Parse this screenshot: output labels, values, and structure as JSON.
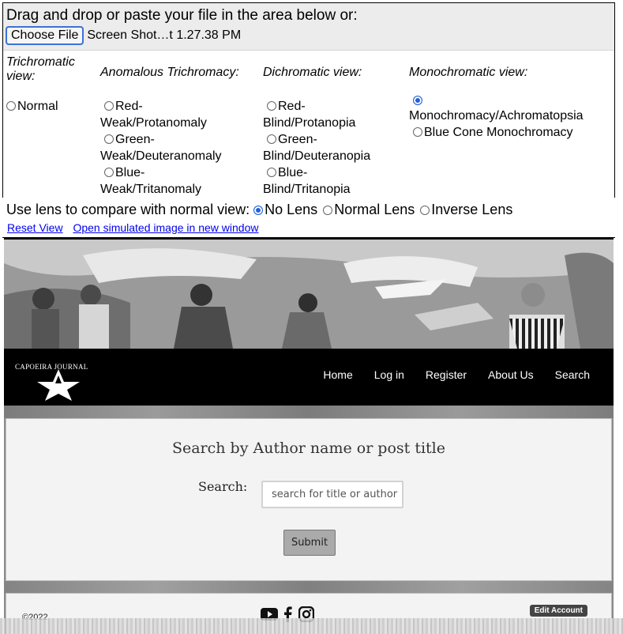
{
  "tool": {
    "drop_label": "Drag and drop or paste your file in the area below or:",
    "choose_file": "Choose File",
    "file_name": "Screen Shot…t 1.27.38 PM",
    "columns": [
      {
        "heading": "Trichromatic view:",
        "options": [
          "Normal"
        ]
      },
      {
        "heading": "Anomalous Trichromacy:",
        "options": [
          "Red-Weak/Protanomaly",
          "Green-Weak/Deuteranomaly",
          "Blue-Weak/Tritanomaly"
        ]
      },
      {
        "heading": "Dichromatic view:",
        "options": [
          "Red-Blind/Protanopia",
          "Green-Blind/Deuteranopia",
          "Blue-Blind/Tritanopia"
        ]
      },
      {
        "heading": "Monochromatic view:",
        "options": [
          "Monochromacy/Achromatopsia",
          "Blue Cone Monochromacy"
        ],
        "selected": "Monochromacy/Achromatopsia"
      }
    ],
    "lens_label": "Use lens to compare with normal view:",
    "lens_options": [
      "No Lens",
      "Normal Lens",
      "Inverse Lens"
    ],
    "lens_selected": "No Lens",
    "reset_link": "Reset View",
    "open_link": "Open simulated image in new window"
  },
  "site": {
    "logo_text": "CAPOEIRA JOURNAL",
    "nav": [
      "Home",
      "Log in",
      "Register",
      "About Us",
      "Search"
    ],
    "search_title": "Search by Author name or post title",
    "search_label": "Search:",
    "search_placeholder": "search for title or author",
    "submit_label": "Submit",
    "copyright": "©2022",
    "edit_account": "Edit Account",
    "social_icons": [
      "youtube-icon",
      "facebook-icon",
      "instagram-icon"
    ]
  }
}
